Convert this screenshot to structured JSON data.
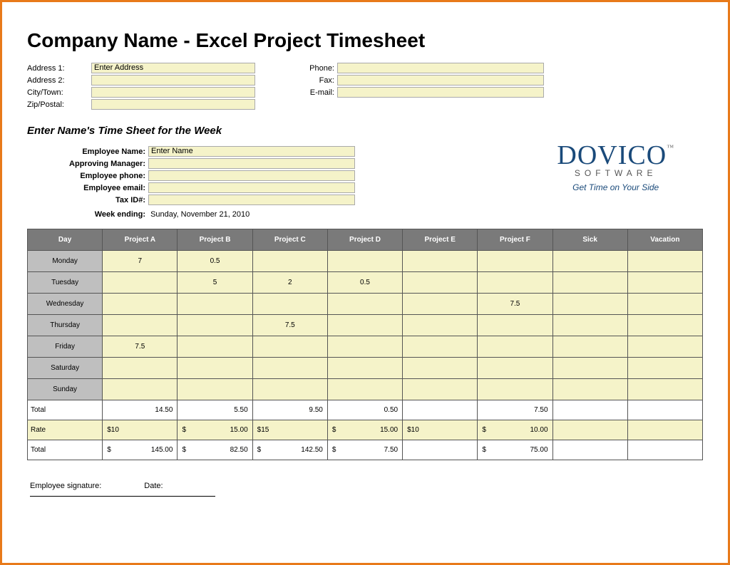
{
  "title": "Company Name - Excel Project Timesheet",
  "address": {
    "addr1_label": "Address 1:",
    "addr1_value": "Enter Address",
    "addr2_label": "Address 2:",
    "addr2_value": "",
    "city_label": "City/Town:",
    "city_value": "",
    "zip_label": "Zip/Postal:",
    "zip_value": ""
  },
  "contact": {
    "phone_label": "Phone:",
    "phone_value": "",
    "fax_label": "Fax:",
    "fax_value": "",
    "email_label": "E-mail:",
    "email_value": ""
  },
  "subtitle": "Enter Name's Time Sheet for the Week",
  "employee": {
    "name_label": "Employee Name:",
    "name_value": "Enter Name",
    "manager_label": "Approving Manager:",
    "manager_value": "",
    "phone_label": "Employee phone:",
    "phone_value": "",
    "email_label": "Employee email:",
    "email_value": "",
    "taxid_label": "Tax ID#:",
    "taxid_value": ""
  },
  "week_ending_label": "Week ending:",
  "week_ending_value": "Sunday, November 21, 2010",
  "logo": {
    "name": "DOVICO",
    "tm": "™",
    "sub": "SOFTWARE",
    "tag": "Get Time on Your Side"
  },
  "headers": [
    "Day",
    "Project A",
    "Project B",
    "Project C",
    "Project D",
    "Project E",
    "Project F",
    "Sick",
    "Vacation"
  ],
  "days": [
    "Monday",
    "Tuesday",
    "Wednesday",
    "Thursday",
    "Friday",
    "Saturday",
    "Sunday"
  ],
  "grid": [
    [
      "7",
      "0.5",
      "",
      "",
      "",
      "",
      "",
      ""
    ],
    [
      "",
      "5",
      "2",
      "0.5",
      "",
      "",
      "",
      ""
    ],
    [
      "",
      "",
      "",
      "",
      "",
      "7.5",
      "",
      ""
    ],
    [
      "",
      "",
      "7.5",
      "",
      "",
      "",
      "",
      ""
    ],
    [
      "7.5",
      "",
      "",
      "",
      "",
      "",
      "",
      ""
    ],
    [
      "",
      "",
      "",
      "",
      "",
      "",
      "",
      ""
    ],
    [
      "",
      "",
      "",
      "",
      "",
      "",
      "",
      ""
    ]
  ],
  "total_label": "Total",
  "totals": [
    "14.50",
    "5.50",
    "9.50",
    "0.50",
    "",
    "7.50",
    "",
    ""
  ],
  "rate_label": "Rate",
  "rates_sym": [
    "$10",
    "$",
    "$15",
    "$",
    "$10",
    "$",
    "",
    ""
  ],
  "rates_val": [
    "",
    "15.00",
    "",
    "15.00",
    "",
    "10.00",
    "",
    ""
  ],
  "grand_label": "Total",
  "grand_sym": [
    "$",
    "$",
    "$",
    "$",
    "",
    "$",
    "",
    ""
  ],
  "grand_val": [
    "145.00",
    "82.50",
    "142.50",
    "7.50",
    "",
    "75.00",
    "",
    ""
  ],
  "sig_employee": "Employee signature:",
  "sig_date": "Date:"
}
